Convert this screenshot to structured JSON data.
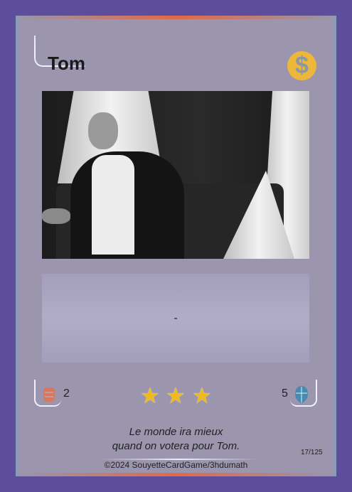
{
  "card": {
    "name": "Tom",
    "cost_icon": "dollar-coin-icon",
    "description": "-",
    "attack": "2",
    "attack_icon": "fist-icon",
    "defense": "5",
    "defense_icon": "shield-icon",
    "stars": 3,
    "quote_line1": "Le monde ira mieux",
    "quote_line2": "quand on votera pour Tom.",
    "copyright": "©2024 SouyetteCardGame/3hdumath",
    "number": "17/125"
  },
  "colors": {
    "background": "#5e4d9a",
    "card": "#9b95ad",
    "coin": "#edb73a",
    "star": "#f0b91c",
    "accent": "#e06a48",
    "attack": "#d9785a",
    "defense": "#4a8ab0"
  }
}
